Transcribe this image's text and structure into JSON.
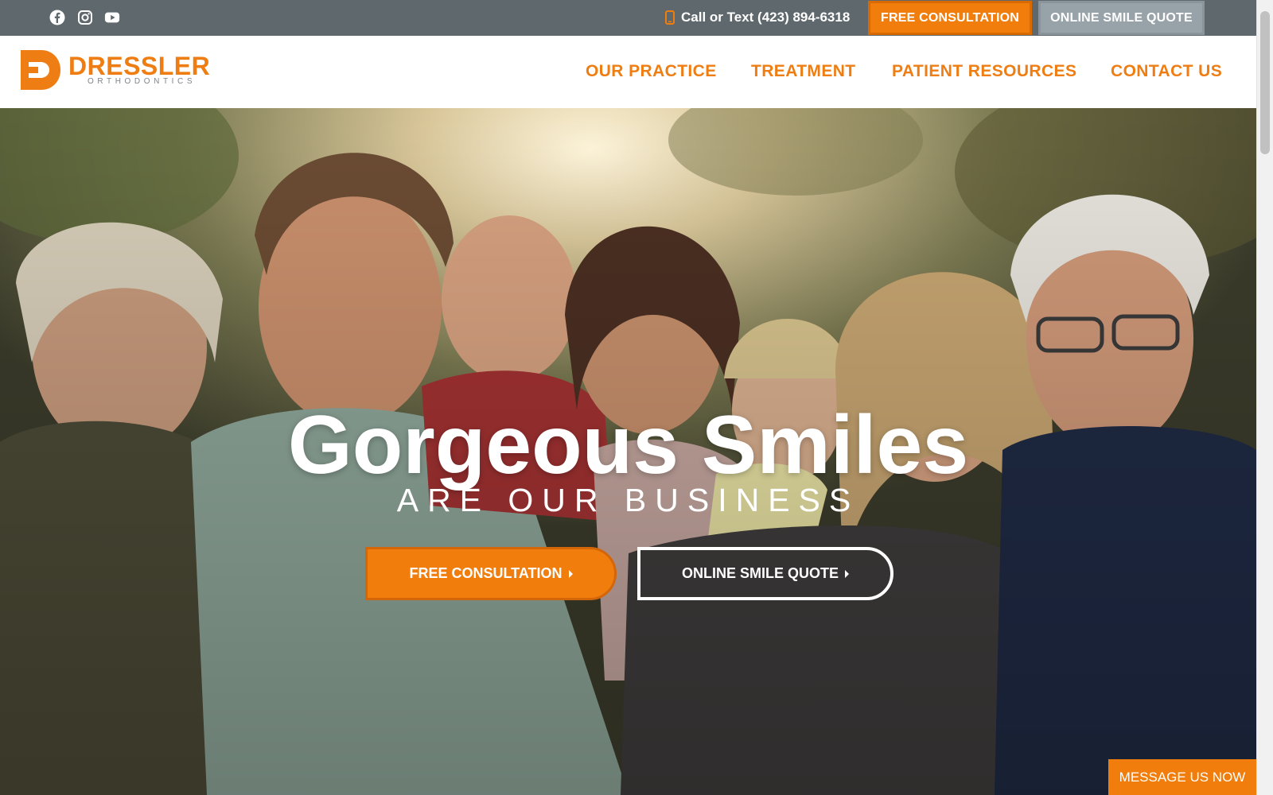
{
  "topbar": {
    "social": [
      {
        "icon": "facebook-icon"
      },
      {
        "icon": "instagram-icon"
      },
      {
        "icon": "youtube-icon"
      }
    ],
    "phone_text": "Call or Text (423) 894-6318",
    "phone_icon": "mobile-phone-icon",
    "consult_label": "FREE CONSULTATION",
    "quote_label": "ONLINE SMILE QUOTE"
  },
  "header": {
    "logo_word": "DRESSLER",
    "logo_sub": "ORTHODONTICS",
    "nav": [
      "OUR PRACTICE",
      "TREATMENT",
      "PATIENT RESOURCES",
      "CONTACT US"
    ]
  },
  "hero": {
    "title": "Gorgeous Smiles",
    "subtitle": "ARE OUR BUSINESS",
    "primary_button": "FREE CONSULTATION",
    "secondary_button": "ONLINE SMILE QUOTE"
  },
  "chat": {
    "label": "MESSAGE US NOW"
  },
  "colors": {
    "brand_orange": "#f07d0c",
    "topbar_gray": "#5f686c",
    "quote_gray": "#98a2a9"
  }
}
